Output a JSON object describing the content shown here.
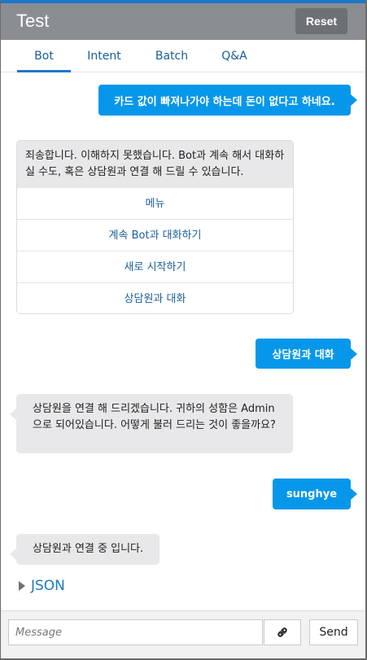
{
  "header": {
    "title": "Test",
    "reset_label": "Reset"
  },
  "tabs": [
    {
      "label": "Bot",
      "active": true
    },
    {
      "label": "Intent",
      "active": false
    },
    {
      "label": "Batch",
      "active": false
    },
    {
      "label": "Q&A",
      "active": false
    }
  ],
  "conversation": {
    "user_msg_1": "카드 값이 빠져나가야 하는데 돈이 없다고 하네요.",
    "bot_card": {
      "text": "죄송합니다. 이해하지 못했습니다.  Bot과 계속 해서 대화하실 수도, 혹은 상담원과 연결 해 드릴 수 있습니다.",
      "buttons": [
        "메뉴",
        "계속 Bot과 대화하기",
        "새로 시작하기",
        "상담원과 대화"
      ]
    },
    "user_msg_2": "상담원과 대화",
    "bot_msg_2": "상담원을 연결 해 드리겠습니다.  귀하의 성함은 Admin 으로 되어있습니다. 어떻게 불러 드리는 것이 좋을까요?",
    "user_msg_3": "sunghye",
    "bot_msg_3": "상담원과 연결 중 입니다."
  },
  "json_toggle_label": "JSON",
  "composer": {
    "placeholder": "Message",
    "value": "",
    "link_icon": "link-icon",
    "send_label": "Send"
  },
  "colors": {
    "accent": "#1e77c9",
    "user_bubble": "#0797ea",
    "bot_bubble": "#e8e8ea",
    "header_bg": "#8a8d92"
  }
}
